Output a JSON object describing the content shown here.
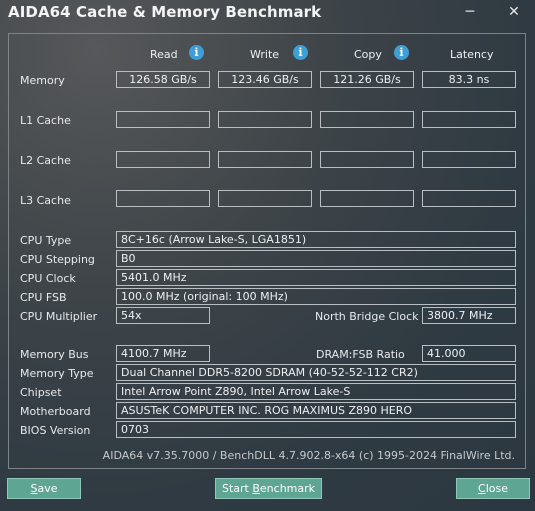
{
  "window": {
    "title": "AIDA64 Cache & Memory Benchmark",
    "minimize": "─",
    "close": "✕"
  },
  "columns": {
    "read": "Read",
    "write": "Write",
    "copy": "Copy",
    "latency": "Latency",
    "info_glyph": "i"
  },
  "rows": {
    "memory": {
      "label": "Memory",
      "read": "126.58 GB/s",
      "write": "123.46 GB/s",
      "copy": "121.26 GB/s",
      "latency": "83.3 ns"
    },
    "l1_cache": {
      "label": "L1 Cache",
      "read": "",
      "write": "",
      "copy": "",
      "latency": ""
    },
    "l2_cache": {
      "label": "L2 Cache",
      "read": "",
      "write": "",
      "copy": "",
      "latency": ""
    },
    "l3_cache": {
      "label": "L3 Cache",
      "read": "",
      "write": "",
      "copy": "",
      "latency": ""
    }
  },
  "cpu": {
    "type_label": "CPU Type",
    "type_value": "8C+16c  (Arrow Lake-S, LGA1851)",
    "stepping_label": "CPU Stepping",
    "stepping_value": "B0",
    "clock_label": "CPU Clock",
    "clock_value": "5401.0 MHz",
    "fsb_label": "CPU FSB",
    "fsb_value": "100.0 MHz  (original: 100 MHz)",
    "multiplier_label": "CPU Multiplier",
    "multiplier_value": "54x",
    "nb_clock_label": "North Bridge Clock",
    "nb_clock_value": "3800.7 MHz"
  },
  "memory_info": {
    "bus_label": "Memory Bus",
    "bus_value": "4100.7 MHz",
    "ratio_label": "DRAM:FSB Ratio",
    "ratio_value": "41.000",
    "type_label": "Memory Type",
    "type_value": "Dual Channel DDR5-8200 SDRAM  (40-52-52-112 CR2)",
    "chipset_label": "Chipset",
    "chipset_value": "Intel Arrow Point Z890, Intel Arrow Lake-S",
    "motherboard_label": "Motherboard",
    "motherboard_value": "ASUSTeK COMPUTER INC. ROG MAXIMUS Z890 HERO",
    "bios_label": "BIOS Version",
    "bios_value": "0703"
  },
  "footer": {
    "version": "AIDA64 v7.35.7000 / BenchDLL 4.7.902.8-x64  (c) 1995-2024 FinalWire Ltd."
  },
  "buttons": {
    "save_hot": "S",
    "save_rest": "ave",
    "start_pre": "Start ",
    "start_hot": "B",
    "start_rest": "enchmark",
    "close_hot": "C",
    "close_rest": "lose"
  },
  "colors": {
    "button_bg": "#5fa594",
    "info_icon": "#3d9fd6",
    "box_border": "#b9bec2"
  }
}
